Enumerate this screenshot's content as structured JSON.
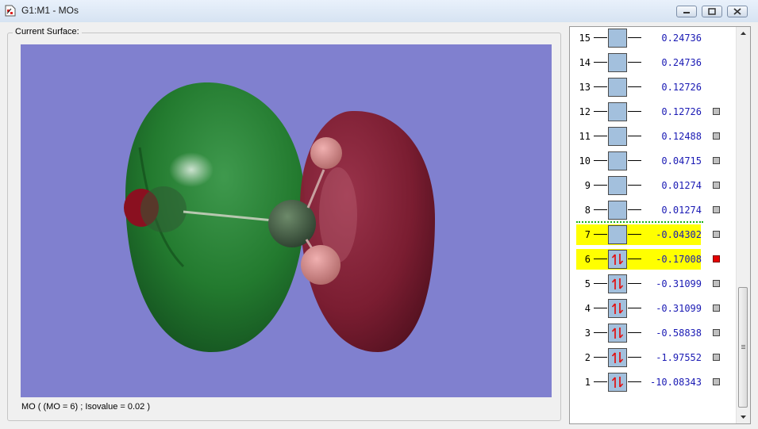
{
  "window": {
    "title": "G1:M1 - MOs"
  },
  "surface": {
    "group_label": "Current Surface:",
    "status": "MO ( (MO = 6) ; Isovalue = 0.02 )"
  },
  "orbitals": [
    {
      "num": "15",
      "energy": "0.24736",
      "occ": 0,
      "checkbox": false,
      "highlight": false,
      "active": false
    },
    {
      "num": "14",
      "energy": "0.24736",
      "occ": 0,
      "checkbox": false,
      "highlight": false,
      "active": false
    },
    {
      "num": "13",
      "energy": "0.12726",
      "occ": 0,
      "checkbox": false,
      "highlight": false,
      "active": false
    },
    {
      "num": "12",
      "energy": "0.12726",
      "occ": 0,
      "checkbox": true,
      "highlight": false,
      "active": false
    },
    {
      "num": "11",
      "energy": "0.12488",
      "occ": 0,
      "checkbox": true,
      "highlight": false,
      "active": false
    },
    {
      "num": "10",
      "energy": "0.04715",
      "occ": 0,
      "checkbox": true,
      "highlight": false,
      "active": false
    },
    {
      "num": "9",
      "energy": "0.01274",
      "occ": 0,
      "checkbox": true,
      "highlight": false,
      "active": false
    },
    {
      "num": "8",
      "energy": "0.01274",
      "occ": 0,
      "checkbox": true,
      "highlight": false,
      "active": false
    },
    {
      "num": "7",
      "energy": "-0.04302",
      "occ": 0,
      "checkbox": true,
      "highlight": true,
      "active": false
    },
    {
      "num": "6",
      "energy": "-0.17008",
      "occ": 2,
      "checkbox": true,
      "highlight": true,
      "active": true
    },
    {
      "num": "5",
      "energy": "-0.31099",
      "occ": 2,
      "checkbox": true,
      "highlight": false,
      "active": false
    },
    {
      "num": "4",
      "energy": "-0.31099",
      "occ": 2,
      "checkbox": true,
      "highlight": false,
      "active": false
    },
    {
      "num": "3",
      "energy": "-0.58838",
      "occ": 2,
      "checkbox": true,
      "highlight": false,
      "active": false
    },
    {
      "num": "2",
      "energy": "-1.97552",
      "occ": 2,
      "checkbox": true,
      "highlight": false,
      "active": false
    },
    {
      "num": "1",
      "energy": "-10.08343",
      "occ": 2,
      "checkbox": true,
      "highlight": false,
      "active": false
    }
  ],
  "colors": {
    "viewport_bg": "#8080cf",
    "positive_lobe": "#1f7a28",
    "negative_lobe": "#7a1a2c",
    "highlight": "#ffff00",
    "energy_text": "#1a1ab4",
    "active_checkbox": "#e60000"
  }
}
